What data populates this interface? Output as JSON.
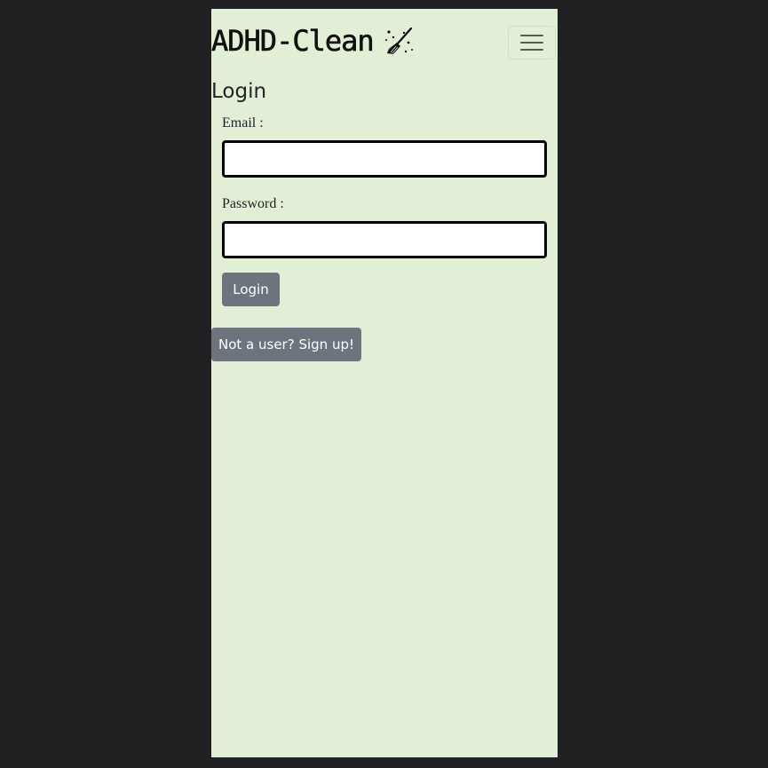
{
  "navbar": {
    "brand": "ADHD-Clean",
    "brand_icon": "broom-sparkle-icon",
    "menu_icon": "hamburger-menu-icon"
  },
  "login_form": {
    "title": "Login",
    "email_label": "Email :",
    "email_value": "",
    "password_label": "Password :",
    "password_value": "",
    "submit_label": "Login"
  },
  "signup": {
    "label": "Not a user? Sign up!"
  },
  "colors": {
    "page_background": "#212124",
    "app_background": "#e0efd6",
    "button": "#6c757d",
    "input_border": "#000000"
  }
}
